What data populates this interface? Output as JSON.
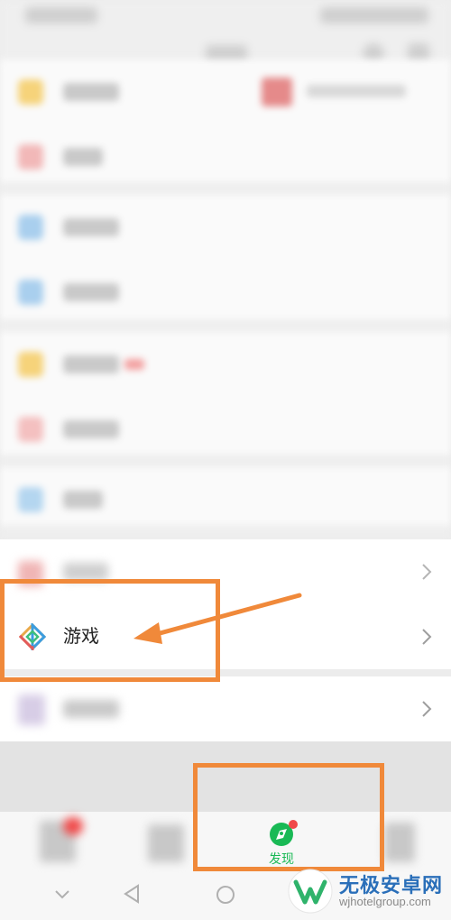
{
  "list": {
    "games_label": "游戏"
  },
  "bottom_nav": {
    "discover_label": "发现"
  },
  "colors": {
    "accent_green": "#19b955",
    "annotation_orange": "#f0893a",
    "badge_red": "#f04a4a"
  },
  "icons": {
    "games": "games-icon",
    "discover": "discover-compass-icon",
    "chevron": "chevron-right-icon"
  },
  "watermark": {
    "title": "无极安卓网",
    "url": "wjhotelgroup.com"
  }
}
